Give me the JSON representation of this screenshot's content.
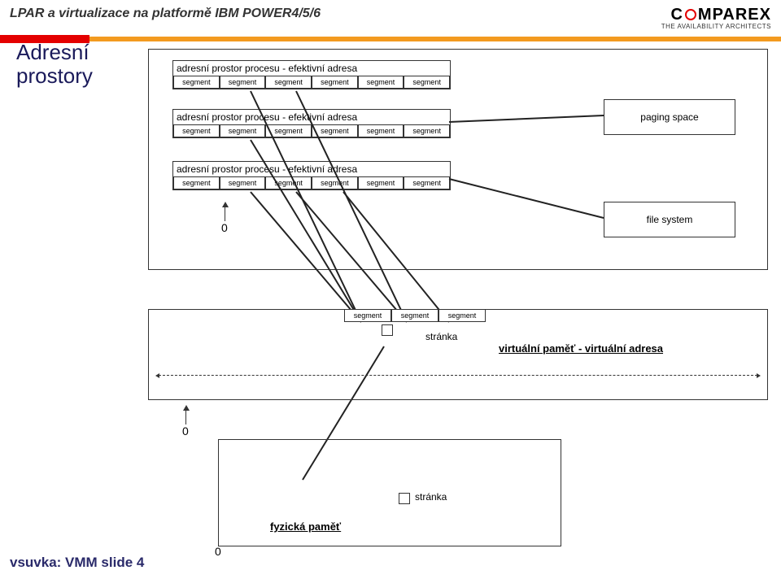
{
  "header": {
    "title": "LPAR a virtualizace na platformě IBM POWER4/5/6",
    "logo_main_pre": "C",
    "logo_main_post": "MPAREX",
    "logo_sub": "THE AVAILABILITY ARCHITECTS"
  },
  "slide_title_l1": "Adresní",
  "slide_title_l2": "prostory",
  "proc_blocks": [
    {
      "title": "adresní prostor procesu - efektivní adresa"
    },
    {
      "title": "adresní prostor procesu - efektivní adresa"
    },
    {
      "title": "adresní prostor procesu - efektivní adresa"
    }
  ],
  "segment_label": "segment",
  "paging_space": "paging space",
  "file_system": "file system",
  "zero": "0",
  "stranka": "stránka",
  "virtual_mem_label": "virtuální paměť - virtuální adresa",
  "phys_mem_label": "fyzická paměť",
  "footer": "vsuvka: VMM slide 4",
  "chart_data": {
    "type": "diagram",
    "title": "Adresní prostory",
    "description": "Three per-process effective address spaces each composed of 6 segments map into a shared virtual address space (segments/pages) backed either by paging space or file system, which then maps to physical memory pages.",
    "address_spaces": {
      "count": 3,
      "label": "adresní prostor procesu - efektivní adresa",
      "segments_per_space": 6
    },
    "backing_stores": [
      "paging space",
      "file system"
    ],
    "virtual_memory": {
      "label": "virtuální paměť - virtuální adresa",
      "visible_segments": 3,
      "unit": "stránka"
    },
    "physical_memory": {
      "label": "fyzická paměť",
      "unit": "stránka"
    },
    "origin_marker": 0
  }
}
